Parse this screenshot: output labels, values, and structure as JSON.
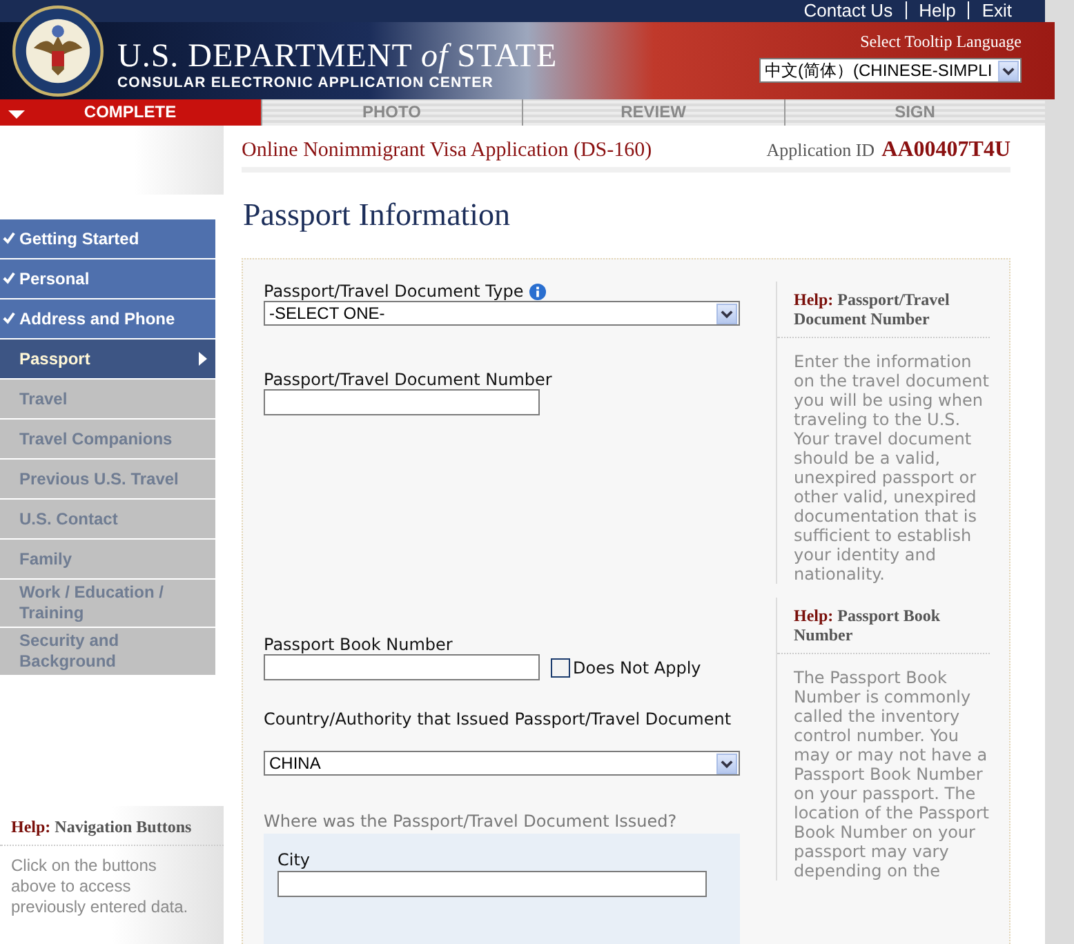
{
  "top_links": [
    "Contact Us",
    "Help",
    "Exit"
  ],
  "header": {
    "title": "U.S. DEPARTMENT *of* STATE",
    "subtitle": "CONSULAR ELECTRONIC APPLICATION CENTER",
    "language_label": "Select Tooltip Language",
    "language_value": "中文(简体）(CHINESE-SIMPLI"
  },
  "steps": [
    {
      "label": "COMPLETE",
      "selected": true
    },
    {
      "label": "PHOTO",
      "selected": false
    },
    {
      "label": "REVIEW",
      "selected": false
    },
    {
      "label": "SIGN",
      "selected": false
    }
  ],
  "application": {
    "title": "Online Nonimmigrant Visa Application (DS-160)",
    "id_label": "Application ID",
    "id": "AA00407T4U"
  },
  "sidebar": {
    "items": [
      {
        "label": "Getting Started",
        "completed": true,
        "selected": false
      },
      {
        "label": "Personal",
        "completed": true,
        "selected": false
      },
      {
        "label": "Address and Phone",
        "completed": true,
        "selected": false
      },
      {
        "label": "Passport",
        "completed": false,
        "selected": true
      },
      {
        "label": "Travel",
        "completed": false,
        "selected": false
      },
      {
        "label": "Travel Companions",
        "completed": false,
        "selected": false
      },
      {
        "label": "Previous U.S. Travel",
        "completed": false,
        "selected": false
      },
      {
        "label": "U.S. Contact",
        "completed": false,
        "selected": false
      },
      {
        "label": "Family",
        "completed": false,
        "selected": false
      },
      {
        "label": "Work / Education / Training",
        "completed": false,
        "selected": false
      },
      {
        "label": "Security and Background",
        "completed": false,
        "selected": false
      }
    ],
    "help": {
      "prefix": "Help:",
      "title": "Navigation Buttons",
      "text": "Click on the buttons above to access previously entered data."
    }
  },
  "page_title": "Passport Information",
  "form": {
    "doc_type": {
      "label": "Passport/Travel Document Type",
      "value": "-SELECT ONE-"
    },
    "doc_number": {
      "label": "Passport/Travel Document Number"
    },
    "book_number": {
      "label": "Passport Book Number",
      "na_label": "Does Not Apply",
      "na_checked": false
    },
    "country": {
      "label": "Country/Authority that Issued Passport/Travel Document",
      "value": "CHINA"
    },
    "issued_where": {
      "label": "Where was the Passport/Travel Document Issued?",
      "city_label": "City"
    }
  },
  "help": [
    {
      "prefix": "Help:",
      "title": "Passport/Travel Document Number",
      "text": "Enter the information on the travel document you will be using when traveling to the U.S. Your travel document should be a valid, unexpired passport or other valid, unexpired documentation that is sufficient to establish your identity and nationality."
    },
    {
      "prefix": "Help:",
      "title": "Passport Book Number",
      "text": "The Passport Book Number is commonly called the inventory control number. You may or may not have a Passport Book Number on your passport. The location of the Passport Book Number on your passport may vary depending on the"
    }
  ]
}
